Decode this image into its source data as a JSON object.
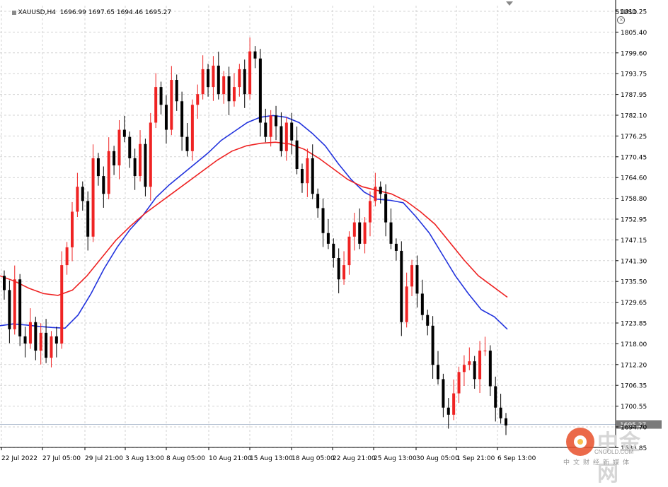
{
  "header": {
    "symbol": "XAUUSD,H4",
    "ohlc": "1696.99 1697.65 1694.46 1695.27",
    "account": "51USD"
  },
  "watermark": {
    "name": "中金网",
    "url": "CNGOLD.COM",
    "tagline": "中文财经新媒体"
  },
  "colors": {
    "bull": "#ef2323",
    "bear": "#000000",
    "ma_fast": "#2233dd",
    "ma_slow": "#ee2222",
    "grid": "#d3d3d3",
    "price_line": "#b8c4d4"
  },
  "chart_data": {
    "type": "candlestick",
    "symbol": "XAUUSD",
    "timeframe": "H4",
    "ylim": [
      1695.0,
      1812.5
    ],
    "y_ticks": [
      "1811.25",
      "1805.40",
      "1799.60",
      "1793.75",
      "1787.95",
      "1782.10",
      "1776.25",
      "1770.45",
      "1764.60",
      "1758.80",
      "1752.95",
      "1747.15",
      "1741.30",
      "1735.50",
      "1729.65",
      "1723.85",
      "1718.00",
      "1712.20",
      "1706.35",
      "1700.55",
      "1694.70",
      "1688.85"
    ],
    "x_ticks": [
      "22 Jul 2022",
      "27 Jul 05:00",
      "29 Jul 21:00",
      "3 Aug 13:00",
      "8 Aug 05:00",
      "10 Aug 21:00",
      "15 Aug 13:00",
      "18 Aug 05:00",
      "22 Aug 21:00",
      "25 Aug 13:00",
      "30 Aug 05:00",
      "1 Sep 21:00",
      "6 Sep 13:00"
    ],
    "current_price": "1695.27",
    "candles_close": [
      1733,
      1722,
      1736,
      1720,
      1718,
      1724,
      1716,
      1721,
      1714,
      1720,
      1718,
      1740,
      1745,
      1755,
      1762,
      1758,
      1748,
      1770,
      1765,
      1760,
      1772,
      1768,
      1778,
      1776,
      1770,
      1765,
      1774,
      1762,
      1780,
      1790,
      1785,
      1778,
      1792,
      1786,
      1776,
      1772,
      1785,
      1788,
      1795,
      1790,
      1796,
      1788,
      1793,
      1786,
      1790,
      1795,
      1788,
      1800,
      1798,
      1780,
      1776,
      1782,
      1779,
      1772,
      1780,
      1775,
      1767,
      1763,
      1770,
      1760,
      1756,
      1749,
      1746,
      1742,
      1736,
      1740,
      1748,
      1752,
      1746,
      1752,
      1758,
      1762,
      1760,
      1752,
      1746,
      1744,
      1724,
      1734,
      1740,
      1732,
      1726,
      1723,
      1712,
      1708,
      1700,
      1698,
      1704,
      1710,
      1712,
      1713,
      1708,
      1716,
      1716,
      1706,
      1700,
      1697,
      1695
    ],
    "series": [
      {
        "name": "MA fast",
        "values": [
          1723,
          1723.5,
          1723.2,
          1722.8,
          1722.5,
          1722.3,
          1726,
          1732,
          1739,
          1745,
          1750,
          1754,
          1759,
          1762.5,
          1765.5,
          1768.5,
          1771.5,
          1775,
          1777.5,
          1780,
          1781.5,
          1782,
          1781.5,
          1780,
          1777,
          1773.5,
          1768.5,
          1764,
          1760.5,
          1758.5,
          1758.2,
          1757.5,
          1753.5,
          1749,
          1743,
          1737,
          1732,
          1727.5,
          1725.5,
          1722
        ]
      },
      {
        "name": "MA slow",
        "values": [
          1737,
          1735.5,
          1733.5,
          1732,
          1731.5,
          1733,
          1737,
          1742,
          1747,
          1751,
          1754.5,
          1757.5,
          1760.5,
          1763.5,
          1766.5,
          1769.5,
          1772,
          1773.5,
          1774.2,
          1774.5,
          1774,
          1772.5,
          1770,
          1767,
          1764,
          1762,
          1761,
          1760,
          1758,
          1755,
          1751.5,
          1746.5,
          1741.5,
          1737,
          1734,
          1731
        ]
      }
    ]
  }
}
